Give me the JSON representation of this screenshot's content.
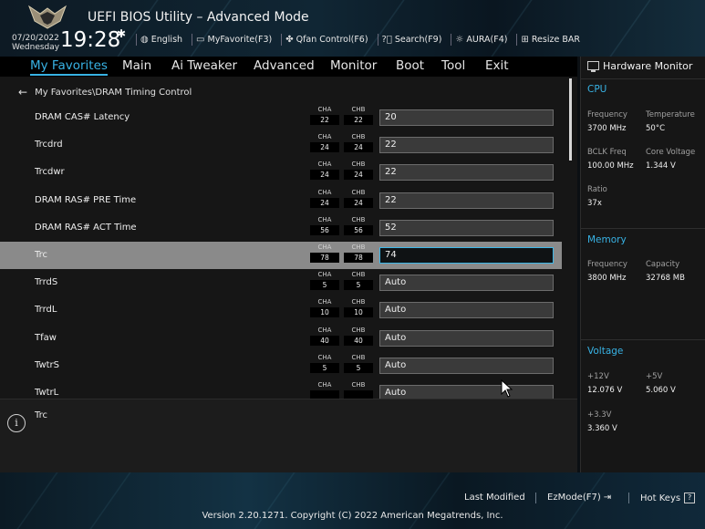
{
  "header": {
    "title": "UEFI BIOS Utility – Advanced Mode",
    "date": "07/20/2022",
    "weekday": "Wednesday",
    "time": "19:28",
    "toolbar": [
      {
        "icon": "globe-icon",
        "label": "English"
      },
      {
        "icon": "myfavorite-icon",
        "label": "MyFavorite(F3)"
      },
      {
        "icon": "fan-icon",
        "label": "Qfan Control(F6)"
      },
      {
        "icon": "search-icon",
        "label": "Search(F9)"
      },
      {
        "icon": "aura-icon",
        "label": "AURA(F4)"
      },
      {
        "icon": "resize-bar-icon",
        "label": "Resize BAR"
      }
    ]
  },
  "menu": {
    "items": [
      "My Favorites",
      "Main",
      "Ai Tweaker",
      "Advanced",
      "Monitor",
      "Boot",
      "Tool",
      "Exit"
    ],
    "active": "My Favorites"
  },
  "breadcrumb": "My Favorites\\DRAM Timing Control",
  "channel_labels": {
    "a": "CHA",
    "b": "CHB"
  },
  "rows": [
    {
      "label": "DRAM CAS# Latency",
      "cha": "22",
      "chb": "22",
      "value": "20"
    },
    {
      "label": "Trcdrd",
      "cha": "24",
      "chb": "24",
      "value": "22"
    },
    {
      "label": "Trcdwr",
      "cha": "24",
      "chb": "24",
      "value": "22"
    },
    {
      "label": "DRAM RAS# PRE Time",
      "cha": "24",
      "chb": "24",
      "value": "22"
    },
    {
      "label": "DRAM RAS# ACT Time",
      "cha": "56",
      "chb": "56",
      "value": "52"
    },
    {
      "label": "Trc",
      "cha": "78",
      "chb": "78",
      "value": "74",
      "selected": true
    },
    {
      "label": "TrrdS",
      "cha": "5",
      "chb": "5",
      "value": "Auto"
    },
    {
      "label": "TrrdL",
      "cha": "10",
      "chb": "10",
      "value": "Auto"
    },
    {
      "label": "Tfaw",
      "cha": "40",
      "chb": "40",
      "value": "Auto"
    },
    {
      "label": "TwtrS",
      "cha": "5",
      "chb": "5",
      "value": "Auto"
    },
    {
      "label": "TwtrL",
      "cha": "",
      "chb": "",
      "value": "Auto"
    }
  ],
  "help": {
    "text": "Trc"
  },
  "hardware_monitor": {
    "title": "Hardware Monitor",
    "cpu": {
      "heading": "CPU",
      "frequency_label": "Frequency",
      "frequency": "3700 MHz",
      "temperature_label": "Temperature",
      "temperature": "50°C",
      "bclk_label": "BCLK Freq",
      "bclk": "100.00 MHz",
      "core_voltage_label": "Core Voltage",
      "core_voltage": "1.344 V",
      "ratio_label": "Ratio",
      "ratio": "37x"
    },
    "memory": {
      "heading": "Memory",
      "frequency_label": "Frequency",
      "frequency": "3800 MHz",
      "capacity_label": "Capacity",
      "capacity": "32768 MB"
    },
    "voltage": {
      "heading": "Voltage",
      "v12_label": "+12V",
      "v12": "12.076 V",
      "v5_label": "+5V",
      "v5": "5.060 V",
      "v33_label": "+3.3V",
      "v33": "3.360 V"
    }
  },
  "footer": {
    "last_modified": "Last Modified",
    "ezmode": "EzMode(F7)",
    "hotkeys": "Hot Keys",
    "copyright": "Version 2.20.1271. Copyright (C) 2022 American Megatrends, Inc."
  },
  "colors": {
    "accent": "#38b2e4",
    "selected_row": "#8a8a8a"
  }
}
